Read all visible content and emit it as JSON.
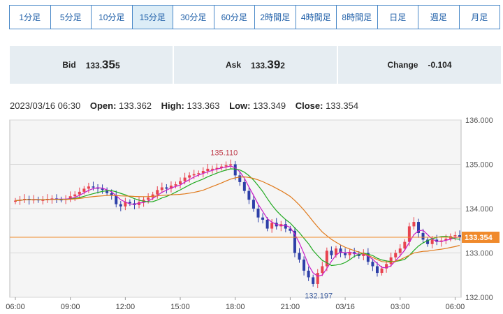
{
  "timeframes": [
    {
      "label": "1分足"
    },
    {
      "label": "5分足"
    },
    {
      "label": "10分足"
    },
    {
      "label": "15分足"
    },
    {
      "label": "30分足"
    },
    {
      "label": "60分足"
    },
    {
      "label": "2時間足"
    },
    {
      "label": "4時間足"
    },
    {
      "label": "8時間足"
    },
    {
      "label": "日足"
    },
    {
      "label": "週足"
    },
    {
      "label": "月足"
    }
  ],
  "active_timeframe": "15分足",
  "quote": {
    "bid_label": "Bid",
    "bid_head": "133.",
    "bid_big": "35",
    "bid_tail": "5",
    "ask_label": "Ask",
    "ask_head": "133.",
    "ask_big": "39",
    "ask_tail": "2",
    "change_label": "Change",
    "change_value": "-0.104"
  },
  "ohlc": {
    "datetime": "2023/03/16 06:30",
    "open_label": "Open:",
    "open": "133.362",
    "high_label": "High:",
    "high": "133.363",
    "low_label": "Low:",
    "low": "133.349",
    "close_label": "Close:",
    "close": "133.354"
  },
  "colors": {
    "up": "#e8434f",
    "down": "#2d3fa8",
    "ma_short": "#c81bc8",
    "ma_mid": "#22aa22",
    "ma_long": "#e07a1c",
    "price_line": "#f08a2c"
  },
  "chart_data": {
    "type": "candlestick",
    "ylim": [
      132.0,
      136.0
    ],
    "yticks": [
      "136.000",
      "135.000",
      "134.000",
      "133.000",
      "132.000"
    ],
    "xticks": [
      {
        "label": "06:00",
        "x": 0
      },
      {
        "label": "09:00",
        "x": 12
      },
      {
        "label": "12:00",
        "x": 24
      },
      {
        "label": "15:00",
        "x": 36
      },
      {
        "label": "18:00",
        "x": 48
      },
      {
        "label": "21:00",
        "x": 60
      },
      {
        "label": "03/16",
        "x": 72
      },
      {
        "label": "03:00",
        "x": 84
      },
      {
        "label": "06:00",
        "x": 96
      }
    ],
    "current_price": 133.354,
    "current_price_label": "133.354",
    "high_annotation": {
      "x": 48,
      "value": 135.11,
      "label": "135.110"
    },
    "low_annotation": {
      "x": 65,
      "value": 132.197,
      "label": "132.197"
    },
    "closes": [
      134.18,
      134.2,
      134.22,
      134.2,
      134.21,
      134.19,
      134.2,
      134.22,
      134.23,
      134.21,
      134.2,
      134.22,
      134.28,
      134.32,
      134.38,
      134.45,
      134.5,
      134.48,
      134.45,
      134.42,
      134.35,
      134.3,
      134.1,
      134.05,
      134.15,
      134.12,
      134.08,
      134.15,
      134.2,
      134.25,
      134.32,
      134.42,
      134.48,
      134.45,
      134.52,
      134.55,
      134.62,
      134.7,
      134.75,
      134.78,
      134.8,
      134.85,
      134.9,
      134.9,
      134.92,
      134.95,
      134.98,
      135.0,
      134.75,
      134.6,
      134.4,
      134.2,
      134.0,
      133.8,
      133.75,
      133.55,
      133.68,
      133.6,
      133.65,
      133.55,
      133.5,
      133.0,
      132.85,
      132.6,
      132.45,
      132.3,
      132.55,
      132.7,
      133.05,
      132.95,
      133.1,
      133.0,
      132.95,
      133.02,
      132.98,
      132.93,
      133.0,
      132.8,
      132.7,
      132.55,
      132.65,
      132.75,
      132.9,
      133.0,
      133.1,
      133.25,
      133.6,
      133.7,
      133.45,
      133.3,
      133.2,
      133.3,
      133.25,
      133.28,
      133.32,
      133.38,
      133.4,
      133.35
    ]
  }
}
